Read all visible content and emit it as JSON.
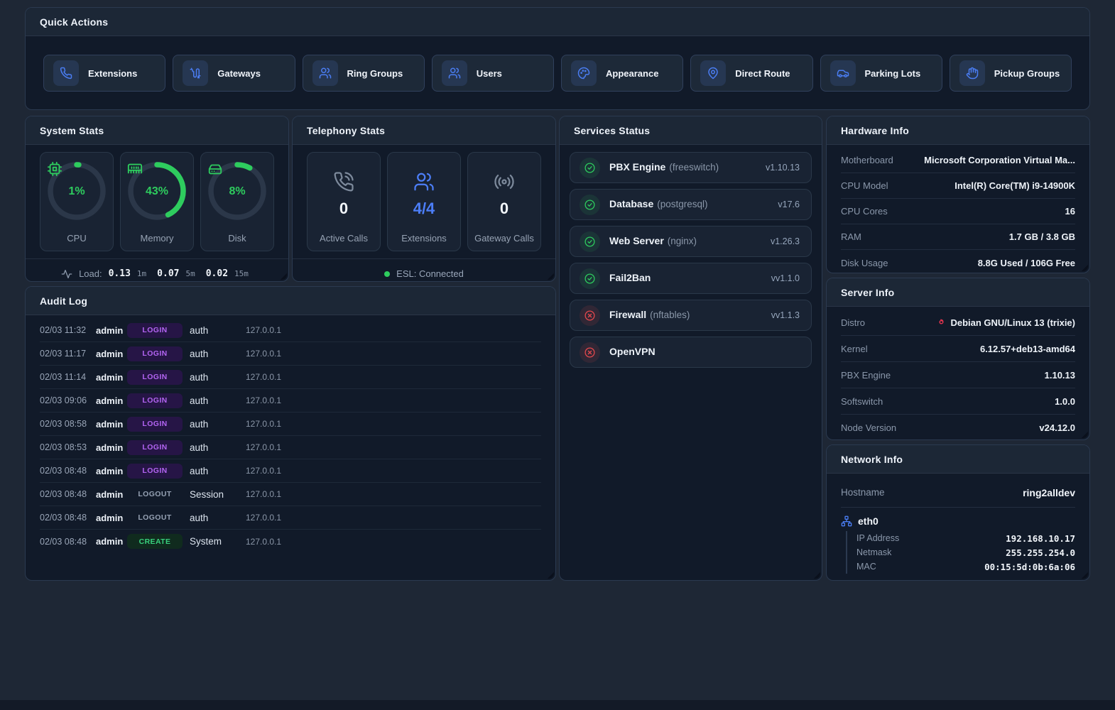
{
  "colors": {
    "accent_green": "#2ecc5e",
    "accent_blue": "#4a7df2",
    "accent_purple": "#b364f2",
    "accent_red": "#e5484d",
    "panel_bg": "#111a29",
    "page_bg": "#1e2735"
  },
  "quick_actions": {
    "title": "Quick Actions",
    "buttons": [
      {
        "label": "Extensions",
        "icon": "phone-icon"
      },
      {
        "label": "Gateways",
        "icon": "cable-icon"
      },
      {
        "label": "Ring Groups",
        "icon": "users-icon"
      },
      {
        "label": "Users",
        "icon": "users-icon"
      },
      {
        "label": "Appearance",
        "icon": "palette-icon"
      },
      {
        "label": "Direct Route",
        "icon": "map-pin-icon"
      },
      {
        "label": "Parking Lots",
        "icon": "car-icon"
      },
      {
        "label": "Pickup Groups",
        "icon": "hand-icon"
      }
    ]
  },
  "system_stats": {
    "title": "System Stats",
    "gauges": [
      {
        "label": "CPU",
        "pct": 1,
        "pct_label": "1%",
        "icon": "cpu-icon"
      },
      {
        "label": "Memory",
        "pct": 43,
        "pct_label": "43%",
        "icon": "memory-icon"
      },
      {
        "label": "Disk",
        "pct": 8,
        "pct_label": "8%",
        "icon": "hard-drive-icon"
      }
    ],
    "load": {
      "label": "Load:",
      "items": [
        {
          "value": "0.13",
          "unit": "1m"
        },
        {
          "value": "0.07",
          "unit": "5m"
        },
        {
          "value": "0.02",
          "unit": "15m"
        }
      ]
    }
  },
  "telephony_stats": {
    "title": "Telephony Stats",
    "tiles": [
      {
        "value": "0",
        "label": "Active Calls",
        "icon": "phone-call-icon",
        "accent": false
      },
      {
        "value": "4/4",
        "label": "Extensions",
        "icon": "users-icon",
        "accent": true
      },
      {
        "value": "0",
        "label": "Gateway Calls",
        "icon": "radio-icon",
        "accent": false
      }
    ],
    "esl_status": "ESL: Connected"
  },
  "services": {
    "title": "Services Status",
    "items": [
      {
        "name": "PBX Engine",
        "sub": "(freeswitch)",
        "version": "v1.10.13",
        "status": "ok"
      },
      {
        "name": "Database",
        "sub": "(postgresql)",
        "version": "v17.6",
        "status": "ok"
      },
      {
        "name": "Web Server",
        "sub": "(nginx)",
        "version": "v1.26.3",
        "status": "ok"
      },
      {
        "name": "Fail2Ban",
        "sub": "",
        "version": "vv1.1.0",
        "status": "ok"
      },
      {
        "name": "Firewall",
        "sub": "(nftables)",
        "version": "vv1.1.3",
        "status": "fail"
      },
      {
        "name": "OpenVPN",
        "sub": "",
        "version": "",
        "status": "fail"
      }
    ]
  },
  "audit_log": {
    "title": "Audit Log",
    "rows": [
      {
        "time": "02/03 11:32",
        "user": "admin",
        "action": "LOGIN",
        "target": "auth",
        "ip": "127.0.0.1"
      },
      {
        "time": "02/03 11:17",
        "user": "admin",
        "action": "LOGIN",
        "target": "auth",
        "ip": "127.0.0.1"
      },
      {
        "time": "02/03 11:14",
        "user": "admin",
        "action": "LOGIN",
        "target": "auth",
        "ip": "127.0.0.1"
      },
      {
        "time": "02/03 09:06",
        "user": "admin",
        "action": "LOGIN",
        "target": "auth",
        "ip": "127.0.0.1"
      },
      {
        "time": "02/03 08:58",
        "user": "admin",
        "action": "LOGIN",
        "target": "auth",
        "ip": "127.0.0.1"
      },
      {
        "time": "02/03 08:53",
        "user": "admin",
        "action": "LOGIN",
        "target": "auth",
        "ip": "127.0.0.1"
      },
      {
        "time": "02/03 08:48",
        "user": "admin",
        "action": "LOGIN",
        "target": "auth",
        "ip": "127.0.0.1"
      },
      {
        "time": "02/03 08:48",
        "user": "admin",
        "action": "LOGOUT",
        "target": "Session",
        "ip": "127.0.0.1"
      },
      {
        "time": "02/03 08:48",
        "user": "admin",
        "action": "LOGOUT",
        "target": "auth",
        "ip": "127.0.0.1"
      },
      {
        "time": "02/03 08:48",
        "user": "admin",
        "action": "CREATE",
        "target": "System",
        "ip": "127.0.0.1"
      }
    ]
  },
  "hardware": {
    "title": "Hardware Info",
    "rows": [
      {
        "label": "Motherboard",
        "value": "Microsoft Corporation Virtual Ma..."
      },
      {
        "label": "CPU Model",
        "value": "Intel(R) Core(TM) i9-14900K"
      },
      {
        "label": "CPU Cores",
        "value": "16"
      },
      {
        "label": "RAM",
        "value": "1.7 GB / 3.8 GB"
      },
      {
        "label": "Disk Usage",
        "value": "8.8G Used / 106G Free"
      }
    ]
  },
  "server": {
    "title": "Server Info",
    "rows": [
      {
        "label": "Distro",
        "value": "Debian GNU/Linux 13 (trixie)"
      },
      {
        "label": "Kernel",
        "value": "6.12.57+deb13-amd64"
      },
      {
        "label": "PBX Engine",
        "value": "1.10.13"
      },
      {
        "label": "Softswitch",
        "value": "1.0.0"
      },
      {
        "label": "Node Version",
        "value": "v24.12.0"
      }
    ]
  },
  "network": {
    "title": "Network Info",
    "hostname_label": "Hostname",
    "hostname": "ring2alldev",
    "interface": {
      "name": "eth0",
      "rows": [
        {
          "label": "IP Address",
          "value": "192.168.10.17"
        },
        {
          "label": "Netmask",
          "value": "255.255.254.0"
        },
        {
          "label": "MAC",
          "value": "00:15:5d:0b:6a:06"
        }
      ]
    }
  }
}
